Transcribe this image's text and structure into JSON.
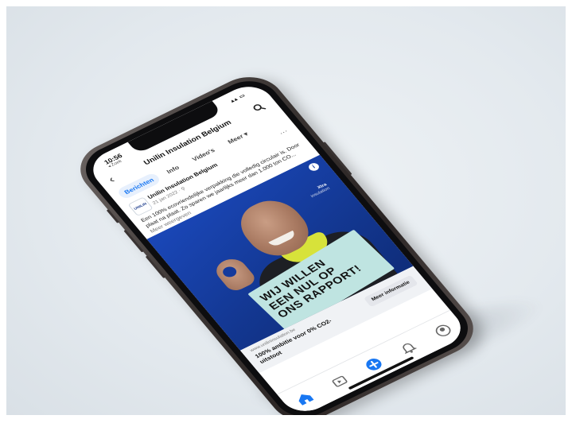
{
  "status": {
    "time": "10:56",
    "back_app": "◂ Zoek"
  },
  "page": {
    "title": "Unilin Insulation Belgium"
  },
  "tabs": [
    {
      "label": "Berichten",
      "active": true
    },
    {
      "label": "Info",
      "active": false
    },
    {
      "label": "Video's",
      "active": false
    },
    {
      "label": "Meer ▾",
      "active": false
    }
  ],
  "post": {
    "author": "Unilin Insulation Belgium",
    "meta": "21 jan 2022 · ⚲",
    "text": "Een 100% ecovriendelijke verpakking die volledig circulair is. Door plaat na plaat. Zo sparen we jaarlijks meer dan 1.000 ton CO...",
    "more_label": "Meer weergeven",
    "logo_text": "UNILIN"
  },
  "ad": {
    "brand_name": "Xtra",
    "brand_sub": "insulation",
    "placard_lines": [
      "WIJ WILLEN",
      "EEN NUL OP",
      "ONS RAPPORT!"
    ]
  },
  "cta_bar": {
    "domain": "www.unilininsulation.be",
    "headline": "100% ambitie voor 0% CO2-uitstoot",
    "button_label": "Meer informatie"
  },
  "bottom_nav": [
    {
      "icon": "home-icon",
      "active": true
    },
    {
      "icon": "watch-icon",
      "active": false
    },
    {
      "icon": "create-post-icon",
      "active": false
    },
    {
      "icon": "notifications-icon",
      "active": false
    },
    {
      "icon": "menu-icon",
      "active": false
    }
  ],
  "colors": {
    "facebook_blue": "#1877f2",
    "ad_background": "#143a9c",
    "placard": "#bfe4e1",
    "collar_yellow": "#d7e23a"
  }
}
